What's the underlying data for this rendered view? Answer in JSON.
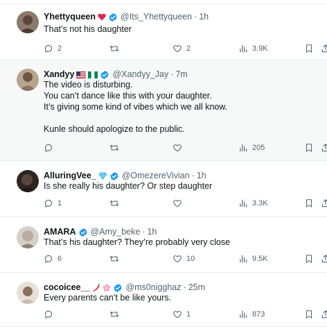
{
  "tweets": [
    {
      "name": "Yhettyqueen",
      "name_emoji": "❤️",
      "handle": "@Its_Yhettyqueen",
      "time": "1h",
      "lines": [
        "That’s not his daughter"
      ],
      "replies": "2",
      "retweets": "",
      "likes": "2",
      "views": "3.9K",
      "avatar_color": "#6b5a4a"
    },
    {
      "name": "Xandyy",
      "name_emoji": "🇺🇸🇳🇬",
      "handle": "@Xandyy_Jay",
      "time": "7m",
      "lines": [
        "The video is disturbing.",
        "You can’t dance like this with your daughter.",
        "It’s giving some kind of vibes which we all know.",
        "",
        "Kunle should apologize to the public."
      ],
      "replies": "",
      "retweets": "",
      "likes": "",
      "views": "205",
      "avatar_color": "#a08a72"
    },
    {
      "name": "AlluringVee_",
      "name_emoji": "💎",
      "handle": "@OmezereVivian",
      "time": "1h",
      "lines": [
        "Is she really his daughter? Or step daughter"
      ],
      "replies": "1",
      "retweets": "",
      "likes": "",
      "views": "3.3K",
      "avatar_color": "#3b2f2a"
    },
    {
      "name": "AMARA",
      "name_emoji": "",
      "handle": "@Amy_beke",
      "time": "1h",
      "lines": [
        "That’s his daughter? They’re probably very close"
      ],
      "replies": "6",
      "retweets": "",
      "likes": "10",
      "views": "9.5K",
      "avatar_color": "#c9c2ba"
    },
    {
      "name": "cocoicee__",
      "name_emoji": "🌶️🌸",
      "handle": "@ms0nigghaz",
      "time": "25m",
      "lines": [
        "Every parents can’t be like yours."
      ],
      "replies": "",
      "retweets": "",
      "likes": "1",
      "views": "873",
      "avatar_color": "#d8d0c6"
    }
  ],
  "colors": {
    "verified": "#1d9bf0",
    "muted": "#536471",
    "highlight": "#f7f9f9",
    "divider": "#e6ecf0"
  },
  "icons": [
    "reply-icon",
    "retweet-icon",
    "like-icon",
    "views-icon",
    "bookmark-icon",
    "share-icon",
    "verified-badge-icon"
  ]
}
